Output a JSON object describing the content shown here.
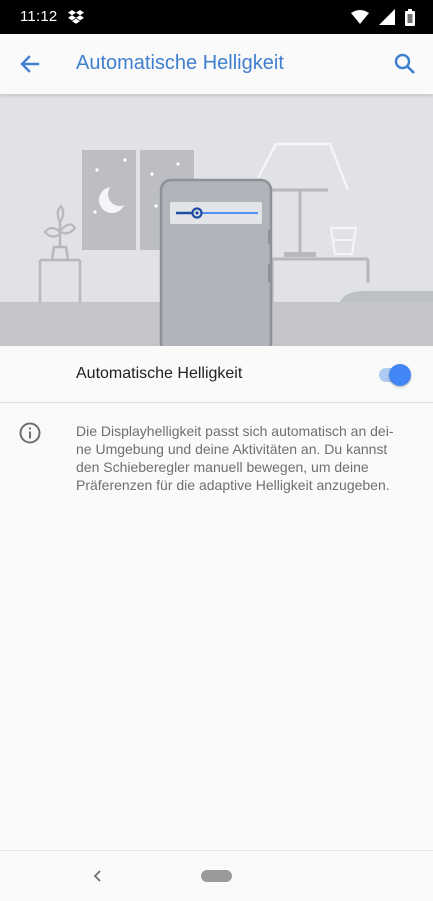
{
  "status_bar": {
    "time": "11:12",
    "icons": [
      "dropbox-icon",
      "wifi-icon",
      "signal-icon",
      "battery-icon"
    ]
  },
  "app_bar": {
    "title": "Automatische Helligkeit",
    "back_icon": "arrow-back-icon",
    "search_icon": "search-icon"
  },
  "setting": {
    "label": "Automatische Helligkeit",
    "enabled": true
  },
  "info": {
    "icon": "info-icon",
    "text": "Die Displayhelligkeit passt sich automatisch an dei-\nne Umgebung und deine Aktivitäten an. Du kannst\nden Schieberegler manuell bewegen, um deine\nPräferenzen für die adaptive Helligkeit anzugeben."
  },
  "nav_bar": {
    "icons": [
      "nav-back-icon",
      "home-pill"
    ]
  },
  "colors": {
    "accent": "#3f7fcf",
    "toggle_on": "#4285f4",
    "toggle_track": "#aecbf1",
    "illustration_bg": "#e1e2e6"
  }
}
